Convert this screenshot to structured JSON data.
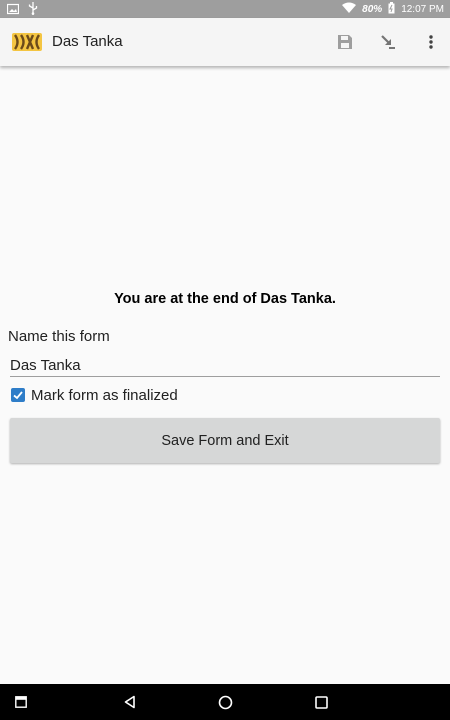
{
  "status_bar": {
    "icons": [
      "image-icon",
      "usb-icon",
      "wifi-icon",
      "battery-icon"
    ],
    "battery": "80%",
    "time": "12:07 PM"
  },
  "app_bar": {
    "title": "Das Tanka",
    "actions": [
      "save-icon",
      "jump-arrow-icon",
      "more-vert-icon"
    ]
  },
  "form_end": {
    "message": "You are at the end of Das Tanka.",
    "name_label": "Name this form",
    "name_value": "Das Tanka",
    "finalize_label": "Mark form as finalized",
    "finalize_checked": true,
    "save_button": "Save Form and Exit"
  },
  "nav_bar": {
    "buttons": [
      "recents-screenshot-icon",
      "back-icon",
      "home-icon",
      "overview-icon"
    ]
  },
  "colors": {
    "status_bar": "#9e9e9e",
    "app_bar": "#f5f5f5",
    "checkbox": "#2e7dc8",
    "button": "#d6d7d7"
  }
}
